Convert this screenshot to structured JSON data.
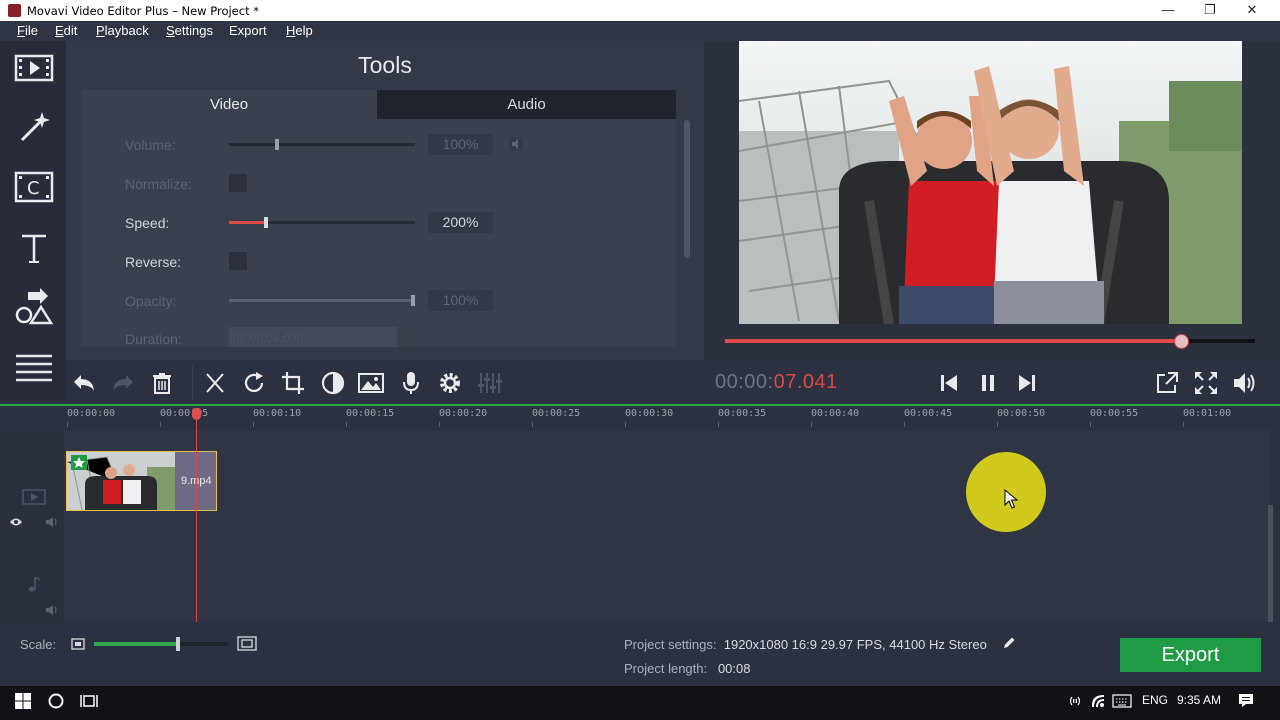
{
  "window": {
    "title": "Movavi Video Editor Plus – New Project *",
    "minimize": "—",
    "restore": "❐",
    "close": "✕"
  },
  "menu": [
    {
      "label": "File",
      "underline": "F",
      "rest": "ile"
    },
    {
      "label": "Edit",
      "underline": "E",
      "rest": "dit"
    },
    {
      "label": "Playback",
      "underline": "P",
      "rest": "layback"
    },
    {
      "label": "Settings",
      "underline": "S",
      "rest": "ettings"
    },
    {
      "label": "Export",
      "underline": "",
      "rest": "Export"
    },
    {
      "label": "Help",
      "underline": "H",
      "rest": "elp"
    }
  ],
  "sidebar": {
    "items": [
      "import-icon",
      "magic-wand-icon",
      "transitions-icon",
      "titles-icon",
      "shapes-icon",
      "menu-list-icon"
    ]
  },
  "tools": {
    "title": "Tools",
    "tabs": {
      "video": "Video",
      "audio": "Audio"
    },
    "properties": {
      "volume": {
        "label": "Volume:",
        "value": "100%",
        "level": 0.26,
        "enabled": false
      },
      "normalize": {
        "label": "Normalize:",
        "enabled": false
      },
      "speed": {
        "label": "Speed:",
        "value": "200%",
        "level": 0.2,
        "enabled": true
      },
      "reverse": {
        "label": "Reverse:",
        "enabled": true
      },
      "opacity": {
        "label": "Opacity:",
        "value": "100%",
        "level": 1.0,
        "enabled": false
      },
      "duration": {
        "label": "Duration:",
        "value": "00:00:04.000",
        "enabled": false
      }
    }
  },
  "player": {
    "timecode_a": "00:00:",
    "timecode_b": "07.041",
    "progress": 0.86
  },
  "timeline": {
    "ticks": [
      "00:00:00",
      "00:00:05",
      "00:00:10",
      "00:00:15",
      "00:00:20",
      "00:00:25",
      "00:00:30",
      "00:00:35",
      "00:00:40",
      "00:00:45",
      "00:00:50",
      "00:00:55",
      "00:01:00"
    ],
    "clip": {
      "name": "9.mp4"
    }
  },
  "bottom": {
    "scale_label": "Scale:",
    "scale_level": 0.63,
    "settings_label": "Project settings:",
    "settings_value": "1920x1080 16:9 29.97 FPS, 44100 Hz Stereo",
    "length_label": "Project length:",
    "length_value": "00:08",
    "export_label": "Export"
  },
  "taskbar": {
    "language": "ENG",
    "time": "9:35 AM"
  },
  "colors": {
    "accent_green": "#1f9a45",
    "accent_red": "#d84848",
    "panel": "#333947"
  }
}
